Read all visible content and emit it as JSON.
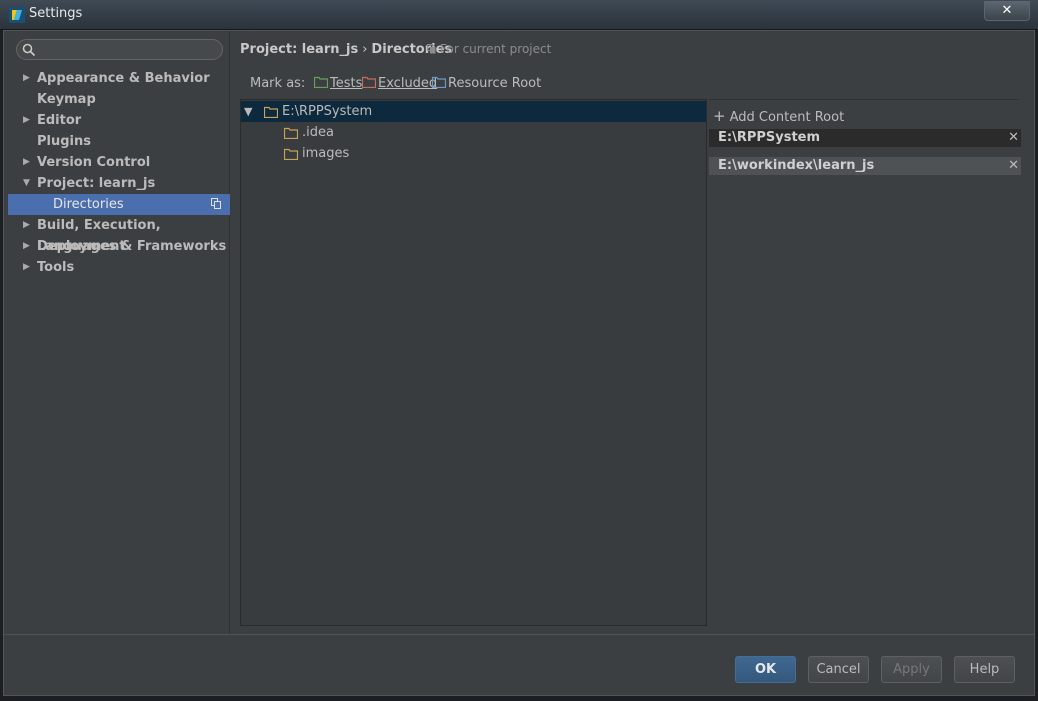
{
  "window": {
    "title": "Settings",
    "close_glyph": "✕",
    "accent": "#4b6eaf"
  },
  "search": {
    "placeholder": "",
    "icon": "search-icon"
  },
  "sidebar": {
    "items": [
      {
        "label": "Appearance & Behavior",
        "arrow": "▶"
      },
      {
        "label": "Keymap",
        "arrow": ""
      },
      {
        "label": "Editor",
        "arrow": "▶"
      },
      {
        "label": "Plugins",
        "arrow": ""
      },
      {
        "label": "Version Control",
        "arrow": "▶"
      },
      {
        "label": "Project: learn_js",
        "arrow": "▼"
      },
      {
        "label": "Directories",
        "arrow": ""
      },
      {
        "label": "Build, Execution, Deployment",
        "arrow": "▶"
      },
      {
        "label": "Languages & Frameworks",
        "arrow": "▶"
      },
      {
        "label": "Tools",
        "arrow": "▶"
      }
    ]
  },
  "header": {
    "crumb_project": "Project: learn_js",
    "crumb_sep": "›",
    "crumb_page": "Directories",
    "scope": "For current project"
  },
  "mark_as": {
    "label": "Mark as:",
    "tests": "Tests",
    "excluded": "Excluded",
    "resource_root": "Resource Root",
    "tests_color": "#6a9f5a",
    "excluded_color": "#c86b5d",
    "resource_color": "#6b9ac8"
  },
  "tree": {
    "root": {
      "name": "E:\\RPPSystem",
      "expander": "▼"
    },
    "children": [
      {
        "name": ".idea"
      },
      {
        "name": "images"
      }
    ],
    "folder_color": "#c8a25a"
  },
  "content_roots": {
    "add_label": "Add Content Root",
    "add_glyph": "+",
    "remove_glyph": "✕",
    "items": [
      {
        "path": "E:\\RPPSystem"
      },
      {
        "path": "E:\\workindex\\learn_js"
      }
    ]
  },
  "footer": {
    "ok": "OK",
    "cancel": "Cancel",
    "apply": "Apply",
    "help": "Help"
  }
}
